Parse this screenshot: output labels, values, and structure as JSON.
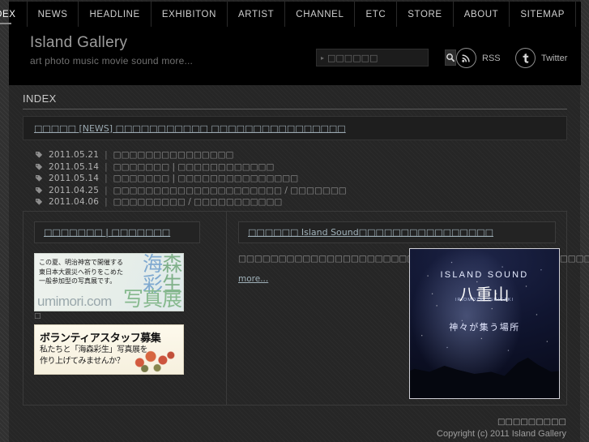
{
  "nav": {
    "items": [
      {
        "label": "INDEX",
        "active": true
      },
      {
        "label": "NEWS",
        "active": false
      },
      {
        "label": "HEADLINE",
        "active": false
      },
      {
        "label": "EXHIBITON",
        "active": false
      },
      {
        "label": "ARTIST",
        "active": false
      },
      {
        "label": "CHANNEL",
        "active": false
      },
      {
        "label": "ETC",
        "active": false
      },
      {
        "label": "STORE",
        "active": false
      },
      {
        "label": "ABOUT",
        "active": false
      },
      {
        "label": "SITEMAP",
        "active": false
      }
    ]
  },
  "header": {
    "site_title": "Island Gallery",
    "tagline": "art photo music movie sound more...",
    "search": {
      "value": "",
      "placeholder": "□□□□□□",
      "caret": "▸",
      "button_icon": "search-icon"
    },
    "social": [
      {
        "label": "RSS",
        "icon": "rss-icon"
      },
      {
        "label": "Twitter",
        "icon": "twitter-icon"
      }
    ]
  },
  "main": {
    "section_title": "INDEX",
    "newsbar": {
      "text": "□□□□□ [NEWS] □□□□□□□□□□□ □□□□□□□□□□□□□□□□"
    },
    "news_items": [
      {
        "icon": "tag-icon",
        "date": "2011.05.21",
        "sep": "|",
        "title": "□□□□□□□□□□□□□□□"
      },
      {
        "icon": "tag-icon",
        "date": "2011.05.14",
        "sep": "|",
        "title": "□□□□□□□ | □□□□□□□□□□□□"
      },
      {
        "icon": "tag-icon",
        "date": "2011.05.14",
        "sep": "|",
        "title": "□□□□□□□ | □□□□□□□□□□□□□□□"
      },
      {
        "icon": "tag-icon",
        "date": "2011.04.25",
        "sep": "|",
        "title": "□□□□□□□□□□□□□□□□□□□□□ / □□□□□□□"
      },
      {
        "icon": "tag-icon",
        "date": "2011.04.06",
        "sep": "|",
        "title": "□□□□□□□□□ / □□□□□□□□□□□"
      }
    ],
    "left_column": {
      "panel_title": "□□□□□□□ | □□□□□□□",
      "banner1": {
        "body_lines": [
          "この夏、明治神宮で開催する",
          "東日本大震災へ祈りをこめた",
          "一般参加型の写真展です。"
        ],
        "kanji_top": [
          "海",
          "森"
        ],
        "kanji_mid": [
          "彩",
          "生"
        ],
        "url": "umimori.com",
        "kanji_bottom": "写真展",
        "caption": "□"
      },
      "banner2": {
        "title": "ボランティアスタッフ募集",
        "body_lines": [
          "私たちと「海森彩生」写真展を",
          "作り上げてみませんか？"
        ]
      }
    },
    "right_column": {
      "panel_title": "□□□□□□ Island Sound□□□□□□□□□□□□□□□□",
      "paragraph": "□□□□□□□□□□□□□□□□□□□□□□□□□□□□□□□□□□□□□□□□□□□□□□□□□□□□□□□□□□□□□□□□□□□□□□□□□□□□□□□□□□□□□□□□□□□□□□□□□□□□□□",
      "more_label": "more...",
      "album": {
        "brand": "ISLAND SOUND",
        "title": "八重山",
        "subtitle": "IRIOMOTE, ISHIGAKI",
        "tagline": "神々が集う場所"
      }
    }
  },
  "footer": {
    "link_label": "□□□□□□□□□",
    "copyright": "Copyright (c) 2011 Island Gallery"
  }
}
